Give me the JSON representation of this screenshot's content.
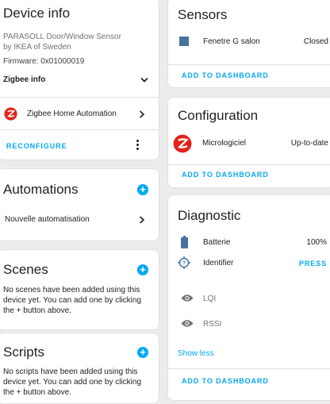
{
  "device_info": {
    "title": "Device info",
    "model": "PARASOLL Door/Window Sensor",
    "manufacturer": "by IKEA of Sweden",
    "firmware": "Firmware: 0x01000019",
    "zigbee_info_label": "Zigbee info",
    "integration_label": "Zigbee Home Automation",
    "reconfigure_label": "RECONFIGURE"
  },
  "automations": {
    "title": "Automations",
    "item_label": "Nouvelle automatisation"
  },
  "scenes": {
    "title": "Scenes",
    "empty_text": "No scenes have been added using this device yet. You can add one by clicking the + button above."
  },
  "scripts": {
    "title": "Scripts",
    "empty_text": "No scripts have been added using this device yet. You can add one by clicking the + button above."
  },
  "sensors": {
    "title": "Sensors",
    "entity_name": "Fenetre G salon",
    "entity_state": "Closed",
    "add_label": "ADD TO DASHBOARD"
  },
  "configuration": {
    "title": "Configuration",
    "entity_name": "Micrologiciel",
    "entity_state": "Up-to-date",
    "add_label": "ADD TO DASHBOARD"
  },
  "diagnostic": {
    "title": "Diagnostic",
    "battery_label": "Batterie",
    "battery_value": "100%",
    "identify_label": "Identifier",
    "identify_action": "PRESS",
    "lqi_label": "LQI",
    "rssi_label": "RSSI",
    "show_less_label": "Show less",
    "add_label": "ADD TO DASHBOARD"
  },
  "colors": {
    "accent": "#03a9f4",
    "zha_red": "#e2231a",
    "sensor_square": "#44739e"
  }
}
